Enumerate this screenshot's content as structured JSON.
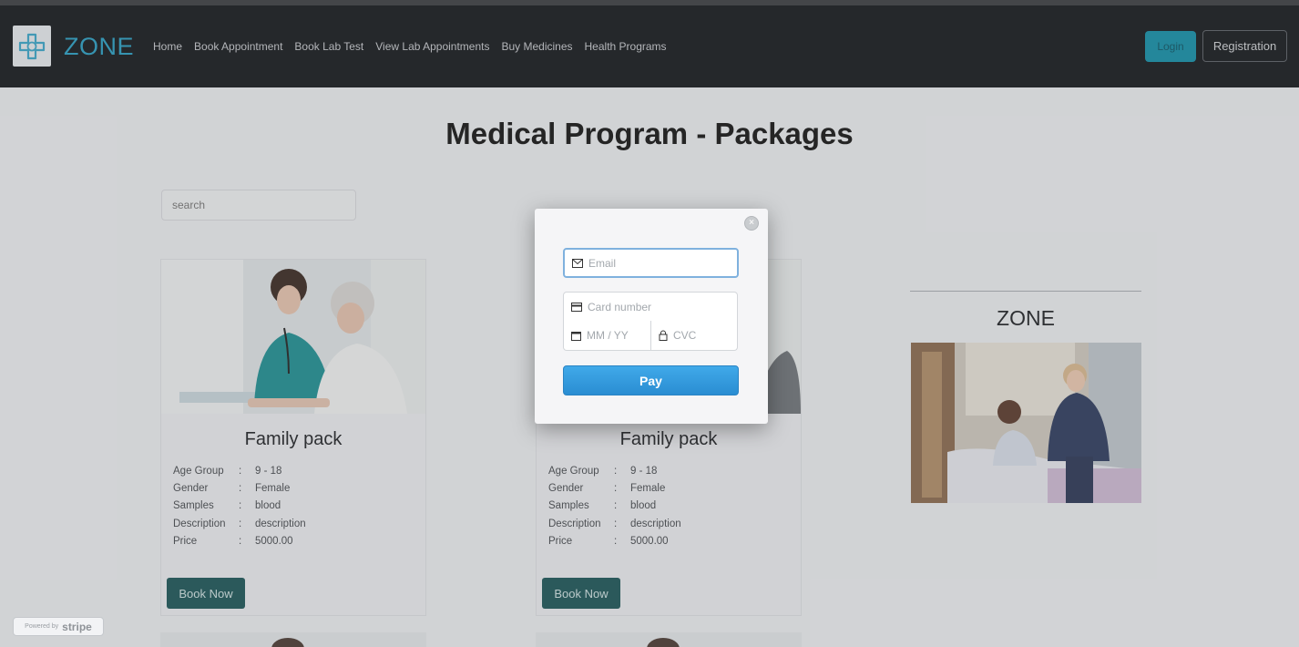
{
  "navbar": {
    "brand": "ZONE",
    "links": [
      "Home",
      "Book Appointment",
      "Book Lab Test",
      "View Lab Appointments",
      "Buy Medicines",
      "Health Programs"
    ],
    "login_label": "Login",
    "registration_label": "Registration"
  },
  "page": {
    "title": "Medical Program - Packages",
    "search_placeholder": "search"
  },
  "cards": [
    {
      "title": "Family pack",
      "rows": [
        {
          "key": "Age Group",
          "value": "9 - 18"
        },
        {
          "key": "Gender",
          "value": "Female"
        },
        {
          "key": "Samples",
          "value": "blood"
        },
        {
          "key": "Description",
          "value": "description"
        },
        {
          "key": "Price",
          "value": "5000.00"
        }
      ],
      "button": "Book Now"
    },
    {
      "title": "Family pack",
      "rows": [
        {
          "key": "Age Group",
          "value": "9 - 18"
        },
        {
          "key": "Gender",
          "value": "Female"
        },
        {
          "key": "Samples",
          "value": "blood"
        },
        {
          "key": "Description",
          "value": "description"
        },
        {
          "key": "Price",
          "value": "5000.00"
        }
      ],
      "button": "Book Now"
    }
  ],
  "separator": ":",
  "sidebar": {
    "title": "ZONE"
  },
  "payment_modal": {
    "email_placeholder": "Email",
    "card_placeholder": "Card number",
    "expiry_placeholder": "MM / YY",
    "cvc_placeholder": "CVC",
    "pay_label": "Pay",
    "close_glyph": "×"
  },
  "stripe_badge": {
    "prefix": "Powered by",
    "brand": "stripe"
  },
  "colors": {
    "navbar_bg": "#15181c",
    "brand": "#2a9fc4",
    "login_bg": "#138fa8",
    "book_button": "#1c5558",
    "pay_button": "#2a8dd2"
  }
}
